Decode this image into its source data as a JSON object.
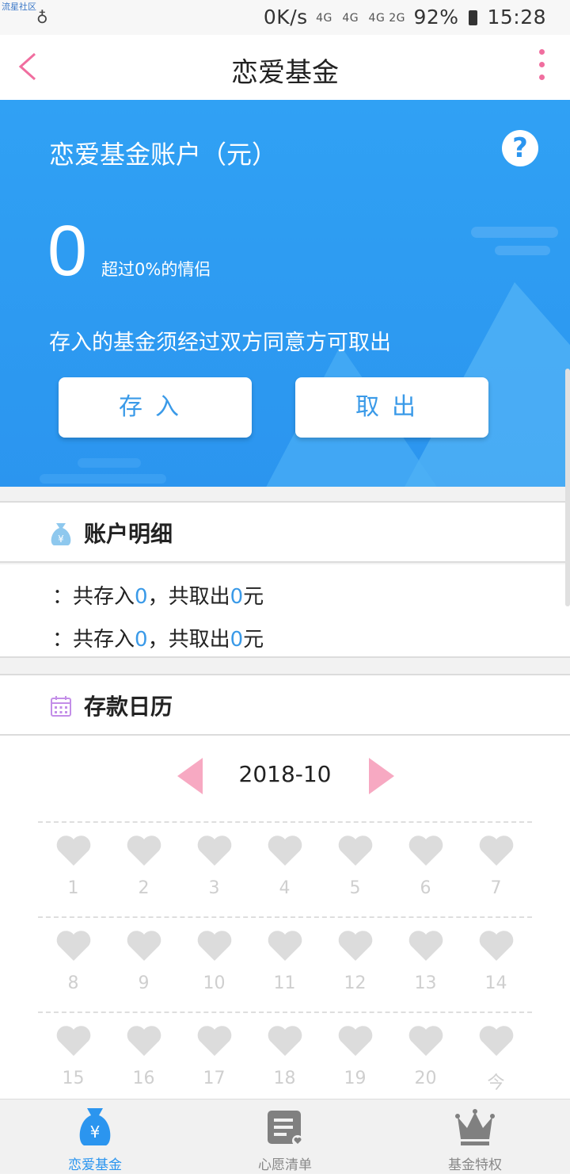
{
  "status_bar": {
    "brand": "流星社区",
    "speed": "0K/s",
    "network": [
      "4G",
      "4G",
      "4G 2G"
    ],
    "battery": "92%",
    "time": "15:28"
  },
  "navbar": {
    "title": "恋爱基金"
  },
  "hero": {
    "account_title": "恋爱基金账户（元）",
    "amount": "0",
    "exceed_text": "超过0%的情侣",
    "note": "存入的基金须经过双方同意方可取出",
    "deposit_label": "存入",
    "withdraw_label": "取出",
    "help_label": "?"
  },
  "account_detail": {
    "title": "账户明细",
    "lines": [
      {
        "prefix": "：共存入",
        "deposit": "0",
        "mid": "，共取出",
        "withdraw": "0",
        "suffix": "元"
      },
      {
        "prefix": "：共存入",
        "deposit": "0",
        "mid": "，共取出",
        "withdraw": "0",
        "suffix": "元"
      }
    ]
  },
  "calendar": {
    "title": "存款日历",
    "month": "2018-10",
    "weeks": [
      [
        "1",
        "2",
        "3",
        "4",
        "5",
        "6",
        "7"
      ],
      [
        "8",
        "9",
        "10",
        "11",
        "12",
        "13",
        "14"
      ],
      [
        "15",
        "16",
        "17",
        "18",
        "19",
        "20",
        "今"
      ]
    ]
  },
  "tabbar": {
    "tabs": [
      {
        "label": "恋爱基金",
        "active": true
      },
      {
        "label": "心愿清单",
        "active": false
      },
      {
        "label": "基金特权",
        "active": false
      }
    ]
  },
  "colors": {
    "accent": "#2b95ef",
    "pink": "#f06e9f",
    "heart": "#dcdcdc"
  }
}
